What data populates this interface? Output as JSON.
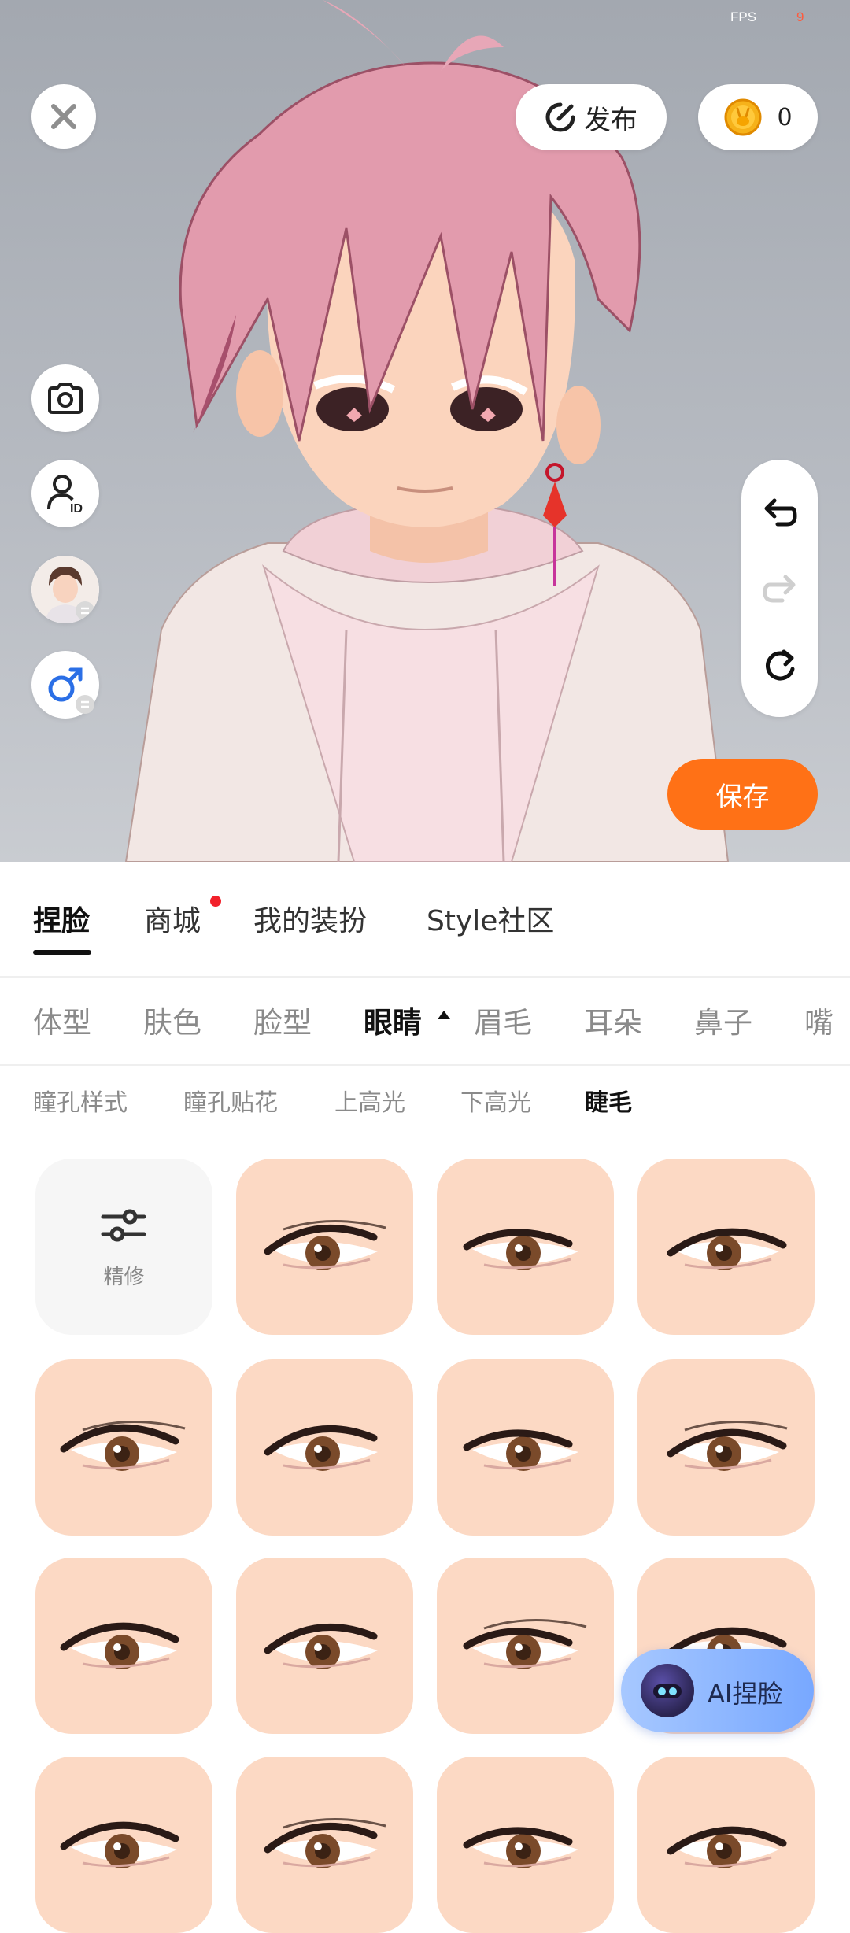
{
  "status": {
    "fps_label": "FPS",
    "fps_value": "9"
  },
  "toolbar": {
    "publish_label": "发布",
    "coin_count": "0",
    "save_label": "保存"
  },
  "main_tabs": [
    {
      "label": "捏脸",
      "active": true
    },
    {
      "label": "商城",
      "has_dot": true
    },
    {
      "label": "我的装扮"
    },
    {
      "label": "Style社区"
    }
  ],
  "categories": [
    "体型",
    "肤色",
    "脸型",
    "眼睛",
    "眉毛",
    "耳朵",
    "鼻子",
    "嘴"
  ],
  "active_category": "眼睛",
  "subcategories": [
    "瞳孔样式",
    "瞳孔贴花",
    "上高光",
    "下高光",
    "睫毛"
  ],
  "active_subcategory": "睫毛",
  "grid": {
    "refine_label": "精修"
  },
  "ai_button": {
    "label": "AI捏脸"
  },
  "colors": {
    "accent": "#ff7116",
    "tile_bg": "#fcd9c4",
    "dot": "#f2212b"
  }
}
